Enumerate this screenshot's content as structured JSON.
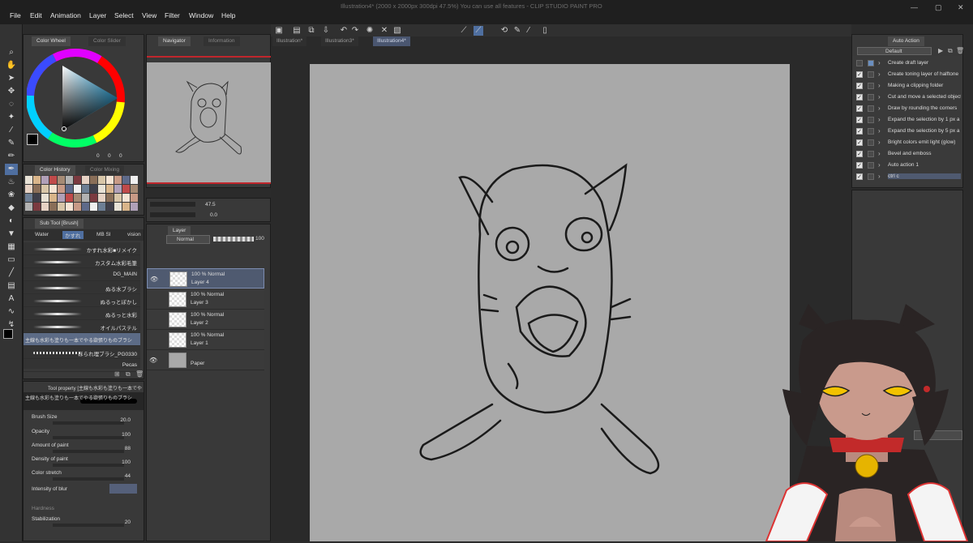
{
  "menu": [
    "File",
    "Edit",
    "Animation",
    "Layer",
    "Select",
    "View",
    "Filter",
    "Window",
    "Help"
  ],
  "title": "Illustration4* (2000 x 2000px 300dpi 47.5%)  You can use all features - CLIP STUDIO PAINT PRO",
  "window_buttons": {
    "minimize": "—",
    "maximize": "▢",
    "close": "✕"
  },
  "color_panel": {
    "tab_active": "Color Wheel",
    "tab_inactive": "Color Slider",
    "values": [
      "0",
      "0",
      "0"
    ],
    "fg_color": "#000000"
  },
  "color_history": {
    "tab_active": "Color History",
    "tab_inactive": "Color Mixing"
  },
  "sub_tool": {
    "header": "Sub Tool [Brush]",
    "groups": [
      "Water",
      "かすれ",
      "MB Sl",
      "vision"
    ],
    "brushes": [
      "かすれ水彩■リメイク",
      "カスタム水彩毛筆",
      "DG_MAIN",
      "ぬる水ブラシ",
      "ぬるっとぼかし",
      "ぬるっと水彩",
      "オイルパステル",
      "主線も水彩も塗りも一本でやる欲張りものブラシ",
      "ほられ埋ブラシ_PG0330",
      "Pecas"
    ],
    "selected_index": 7
  },
  "tool_property": {
    "header": "Tool property [主線も水彩も塗りも一本でや",
    "brush_name": "主線も水彩も塗りも一本でやる欲張りものブラシ",
    "props": [
      {
        "name": "Brush Size",
        "value": "20.0"
      },
      {
        "name": "Opacity",
        "value": "100"
      },
      {
        "name": "Amount of paint",
        "value": "88"
      },
      {
        "name": "Density of paint",
        "value": "100"
      },
      {
        "name": "Color stretch",
        "value": "44"
      },
      {
        "name": "Intensity of blur",
        "value": ""
      },
      {
        "name": "Hardness",
        "value": ""
      },
      {
        "name": "Stabilization",
        "value": "20"
      }
    ]
  },
  "navigator": {
    "tab_active": "Navigator",
    "tab_inactive": "Information",
    "zoom": "47.5",
    "angle": "0.0"
  },
  "layer_panel": {
    "tab": "Layer",
    "blend_mode": "Normal",
    "opacity": "100",
    "layers": [
      {
        "line1": "100 % Normal",
        "line2": "Layer 4",
        "selected": true
      },
      {
        "line1": "100 % Normal",
        "line2": "Layer 3",
        "selected": false
      },
      {
        "line1": "100 % Normal",
        "line2": "Layer 2",
        "selected": false
      },
      {
        "line1": "100 % Normal",
        "line2": "Layer 1",
        "selected": false
      },
      {
        "line1": "",
        "line2": "Paper",
        "selected": false
      }
    ]
  },
  "doc_tabs": [
    {
      "label": "Illustration*",
      "active": false
    },
    {
      "label": "Illustration3*",
      "active": false
    },
    {
      "label": "Illustration4*",
      "active": true
    }
  ],
  "auto_action": {
    "tab": "Auto Action",
    "set": "Default",
    "actions": [
      "Create draft layer",
      "Create toning layer of halftone",
      "Making a clipping folder",
      "Cut and move a selected object",
      "Draw by rounding the corners",
      "Expand the selection by 1 px a",
      "Expand the selection by 5 px a",
      "Bright colors emit light (glow)",
      "Bevel and emboss",
      "Auto action 1",
      "ctrl c"
    ],
    "selected_index": 10
  },
  "colors": {
    "canvas_bg": "#a9a9a9",
    "workspace": "#2a2a2a",
    "accent": "#4f5a70",
    "red_line": "#c0262c"
  }
}
